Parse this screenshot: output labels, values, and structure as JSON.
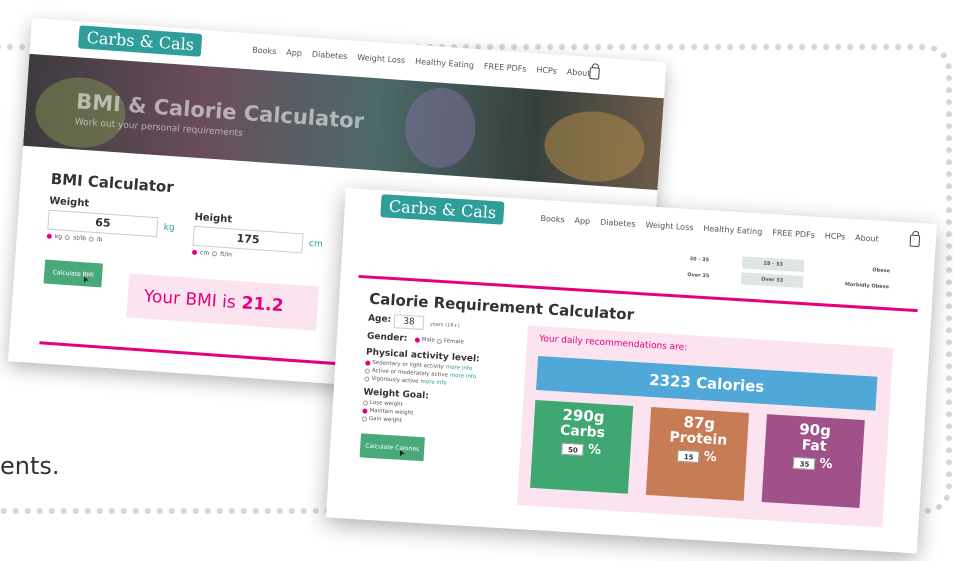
{
  "background": {
    "partial_text": "ents."
  },
  "colors": {
    "brand_teal": "#2f9d9a",
    "accent_pink": "#e6007e",
    "button_green": "#4aa97b",
    "calorie_blue": "#4fa8d8",
    "carbs_green": "#3fa772",
    "protein_brown": "#c77c55",
    "fat_purple": "#a0518a"
  },
  "back_card": {
    "logo": "Carbs & Cals",
    "nav": [
      "Books",
      "App",
      "Diabetes",
      "Weight Loss",
      "Healthy Eating",
      "FREE PDFs",
      "HCPs",
      "About"
    ],
    "cart_icon": "shopping-bag-icon",
    "hero_title": "BMI & Calorie Calculator",
    "hero_subtitle": "Work out your personal requirements",
    "bmi_heading": "BMI Calculator",
    "weight_label": "Weight",
    "weight_value": "65",
    "weight_unit": "kg",
    "weight_options": [
      "kg",
      "st/lb",
      "lb"
    ],
    "height_label": "Height",
    "height_value": "175",
    "height_unit": "cm",
    "height_options": [
      "cm",
      "ft/in"
    ],
    "calc_button": "Calculate BMI",
    "result_prefix": "Your BMI is",
    "result_value": "21.2"
  },
  "front_card": {
    "logo": "Carbs & Cals",
    "nav": [
      "Books",
      "App",
      "Diabetes",
      "Weight Loss",
      "Healthy Eating",
      "FREE PDFs",
      "HCPs",
      "About"
    ],
    "cart_icon": "shopping-bag-icon",
    "bmi_table_rows": [
      [
        "30 - 35",
        "28 - 33",
        "Obese"
      ],
      [
        "Over 35",
        "Over 33",
        "Morbidly Obese"
      ]
    ],
    "heading": "Calorie Requirement Calculator",
    "age_label": "Age:",
    "age_value": "38",
    "age_note": "years (16+)",
    "gender_label": "Gender:",
    "gender_options": [
      "Male",
      "Female"
    ],
    "activity_label": "Physical activity level:",
    "activity_options": [
      {
        "text": "Sedentary or light activity",
        "link": "more info"
      },
      {
        "text": "Active or moderately active",
        "link": "more info"
      },
      {
        "text": "Vigorously active",
        "link": "more info"
      }
    ],
    "goal_label": "Weight Goal:",
    "goal_options": [
      "Lose weight",
      "Maintain weight",
      "Gain weight"
    ],
    "calc_button": "Calculate Calories",
    "rec_title": "Your daily recommendations are:",
    "calories": "2323 Calories",
    "carbs_amount": "290g",
    "carbs_label": "Carbs",
    "carbs_pct": "50",
    "protein_amount": "87g",
    "protein_label": "Protein",
    "protein_pct": "15",
    "fat_amount": "90g",
    "fat_label": "Fat",
    "fat_pct": "35",
    "pct_sign": "%"
  }
}
